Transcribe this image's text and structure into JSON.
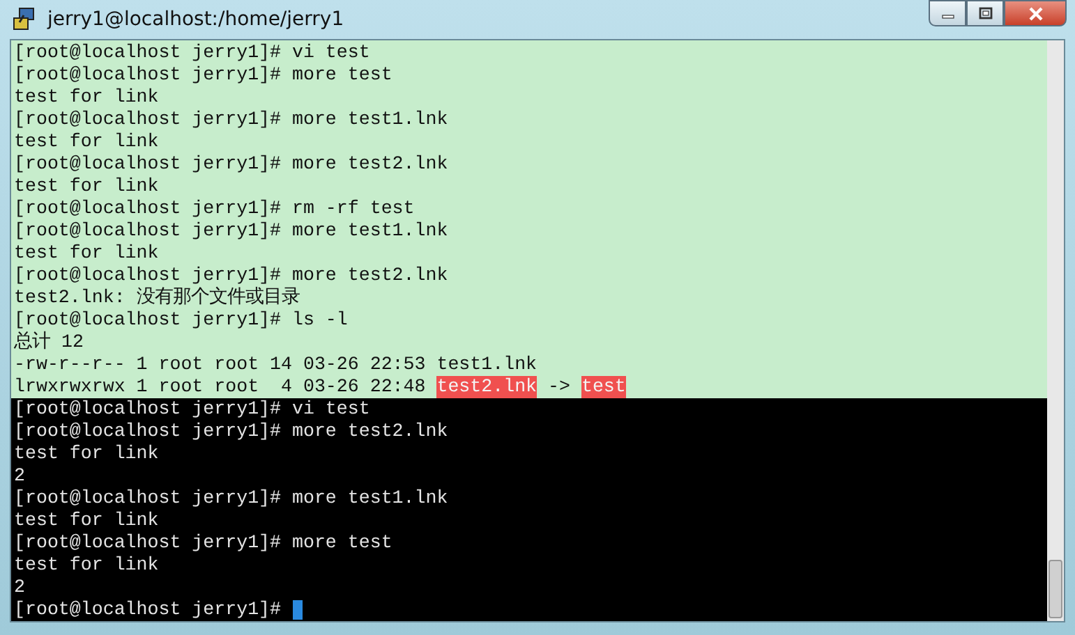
{
  "window": {
    "title": "jerry1@localhost:/home/jerry1"
  },
  "sections": [
    {
      "kind": "light",
      "lines": [
        {
          "text": "[root@localhost jerry1]# vi test"
        },
        {
          "text": "[root@localhost jerry1]# more test"
        },
        {
          "text": "test for link"
        },
        {
          "text": "[root@localhost jerry1]# more test1.lnk"
        },
        {
          "text": "test for link"
        },
        {
          "text": "[root@localhost jerry1]# more test2.lnk"
        },
        {
          "text": "test for link"
        },
        {
          "text": "[root@localhost jerry1]# rm -rf test"
        },
        {
          "text": "[root@localhost jerry1]# more test1.lnk"
        },
        {
          "text": "test for link"
        },
        {
          "text": "[root@localhost jerry1]# more test2.lnk"
        },
        {
          "text": "test2.lnk: 没有那个文件或目录"
        },
        {
          "text": "[root@localhost jerry1]# ls -l"
        },
        {
          "text": "总计 12"
        },
        {
          "text": "-rw-r--r-- 1 root root 14 03-26 22:53 test1.lnk"
        },
        {
          "parts": [
            {
              "text": "lrwxrwxrwx 1 root root  4 03-26 22:48 ",
              "highlight": false
            },
            {
              "text": "test2.lnk",
              "highlight": true
            },
            {
              "text": " -> ",
              "highlight": false
            },
            {
              "text": "test",
              "highlight": true
            }
          ]
        }
      ]
    },
    {
      "kind": "dark",
      "lines": [
        {
          "text": "[root@localhost jerry1]# vi test"
        },
        {
          "text": "[root@localhost jerry1]# more test2.lnk"
        },
        {
          "text": "test for link"
        },
        {
          "text": "2"
        },
        {
          "text": "[root@localhost jerry1]# more test1.lnk"
        },
        {
          "text": "test for link"
        },
        {
          "text": "[root@localhost jerry1]# more test"
        },
        {
          "text": "test for link"
        },
        {
          "text": "2"
        },
        {
          "text": "[root@localhost jerry1]# ",
          "cursor": true
        }
      ]
    }
  ]
}
